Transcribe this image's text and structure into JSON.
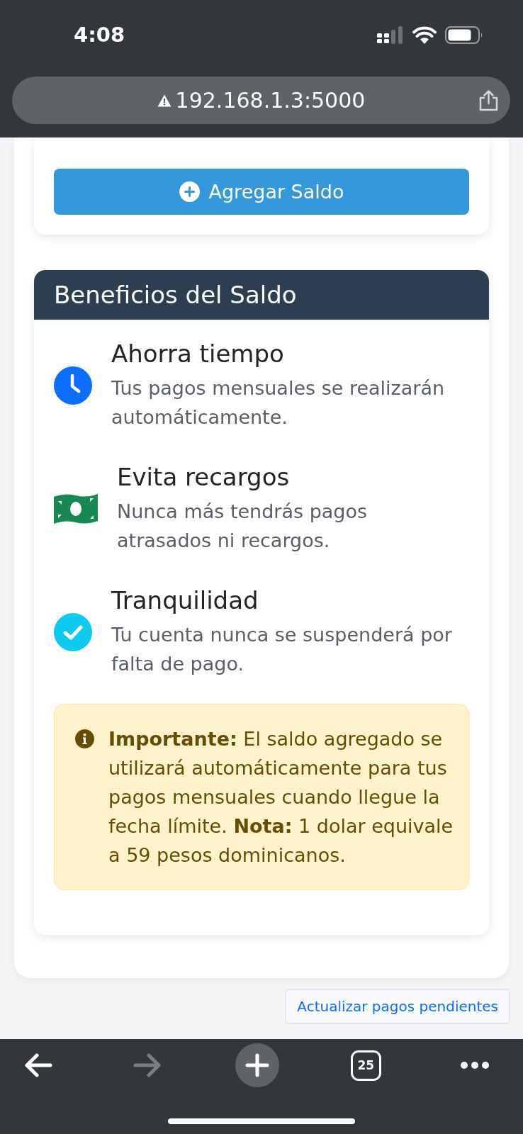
{
  "status_bar": {
    "time": "4:08"
  },
  "address_bar": {
    "url": "192.168.1.3:5000"
  },
  "balance_card": {
    "add_button": {
      "label": "Agregar Saldo"
    }
  },
  "benefits": {
    "title": "Beneficios del Saldo",
    "items": [
      {
        "title": "Ahorra tiempo",
        "description": "Tus pagos mensuales se realizarán automáticamente.",
        "color": "#0d6efd"
      },
      {
        "title": "Evita recargos",
        "description": "Nunca más tendrás pagos atrasados ni recargos.",
        "color": "#198754"
      },
      {
        "title": "Tranquilidad",
        "description": "Tu cuenta nunca se suspenderá por falta de pago.",
        "color": "#0dcaf0"
      }
    ],
    "notice": {
      "text": "**Importante:** El saldo agregado se utilizará automáticamente para tus pagos mensuales cuando llegue la fecha límite. **Nota:** 1 dolar equivale a 59 pesos dominicanos."
    }
  },
  "update_button": {
    "label": "Actualizar pagos pendientes"
  },
  "toolbar": {
    "back": {
      "disabled": false
    },
    "forward": {
      "disabled": true
    },
    "tab_count": "25"
  }
}
